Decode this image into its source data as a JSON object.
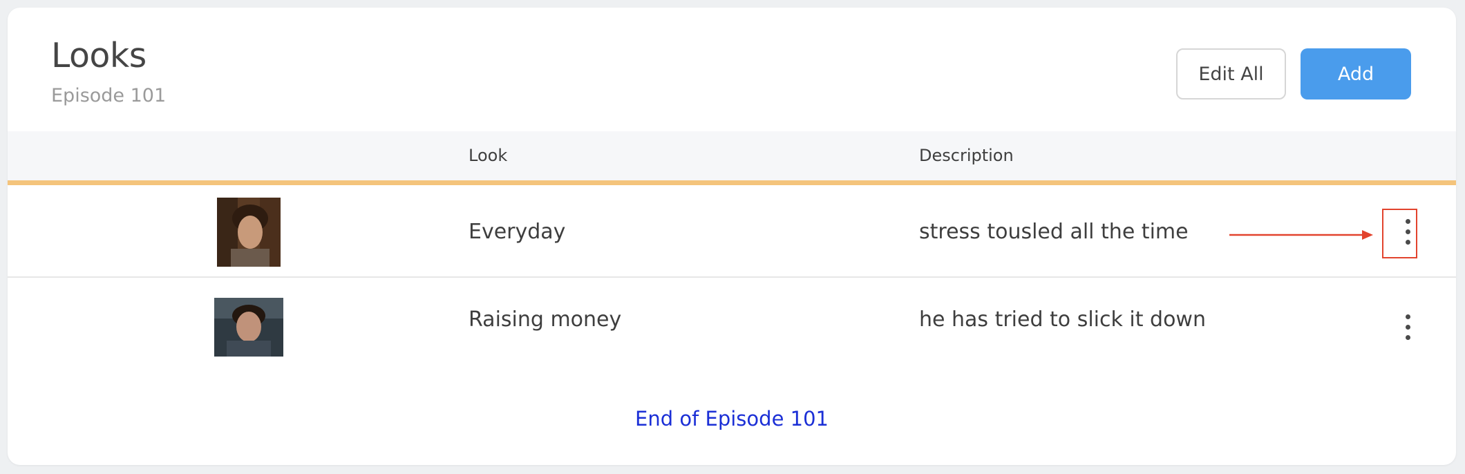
{
  "header": {
    "title": "Looks",
    "subtitle": "Episode 101",
    "edit_all_label": "Edit All",
    "add_label": "Add"
  },
  "table": {
    "columns": [
      "",
      "Look",
      "Description"
    ],
    "rows": [
      {
        "look": "Everyday",
        "description": "stress tousled all the time",
        "menu_icon": "kebab-menu-icon",
        "highlighted": true
      },
      {
        "look": "Raising money",
        "description": "he has tried to slick it down",
        "menu_icon": "kebab-menu-icon",
        "highlighted": false
      }
    ]
  },
  "footer": {
    "end_label": "End of Episode 101"
  },
  "colors": {
    "accent_blue": "#4a9cec",
    "divider_accent": "#f4c47c",
    "annotation_red": "#e2432d",
    "link_blue": "#1b2fd6"
  }
}
